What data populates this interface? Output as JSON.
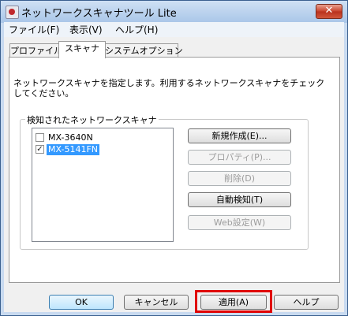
{
  "window": {
    "title": "ネットワークスキャナツール Lite",
    "close_glyph": "✕"
  },
  "menubar": {
    "items": [
      "ファイル(F)",
      "表示(V)",
      "ヘルプ(H)"
    ]
  },
  "tabs": [
    {
      "label": "プロファイル",
      "active": false
    },
    {
      "label": "スキャナ",
      "active": true
    },
    {
      "label": "システムオプション",
      "active": false
    }
  ],
  "scanner_tab": {
    "description": "ネットワークスキャナを指定します。利用するネットワークスキャナをチェックしてください。",
    "group_label": "検知されたネットワークスキャナ",
    "scanners": [
      {
        "name": "MX-3640N",
        "checked": false,
        "selected": false
      },
      {
        "name": "MX-5141FN",
        "checked": true,
        "selected": true
      }
    ],
    "check_glyph": "✓",
    "buttons": {
      "new": "新規作成(E)...",
      "properties": "プロパティ(P)...",
      "delete": "削除(D)",
      "autodetect": "自動検知(T)",
      "web_settings": "Web設定(W)"
    }
  },
  "footer": {
    "ok": "OK",
    "cancel": "キャンセル",
    "apply": "適用(A)",
    "help": "ヘルプ"
  },
  "colors": {
    "selection": "#3399ff",
    "highlight": "#e00000",
    "close_button": "#c8422b"
  }
}
